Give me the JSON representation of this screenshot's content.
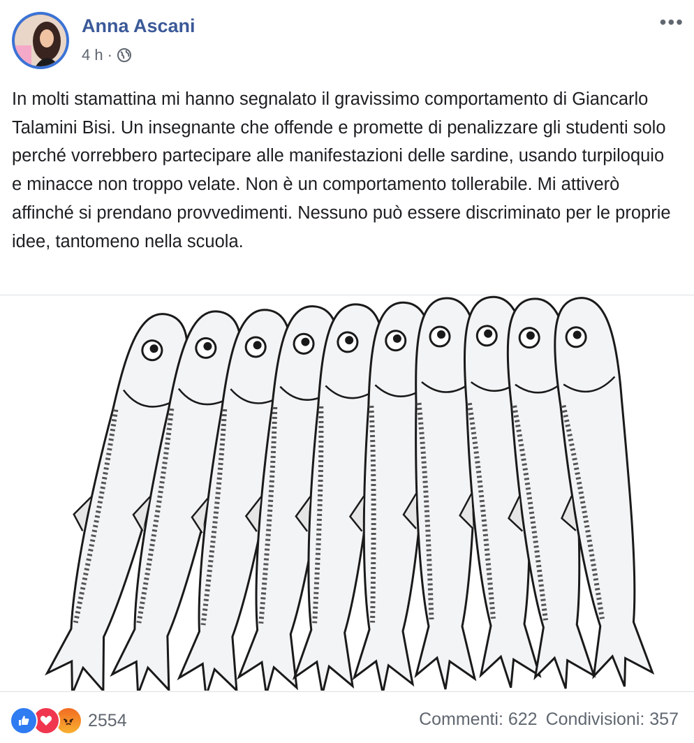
{
  "post": {
    "author": "Anna Ascani",
    "time": "4 h",
    "separator": "·",
    "more_label": "•••",
    "text": "In molti stamattina mi hanno segnalato il gravissimo comportamento di Giancarlo Talamini Bisi. Un insegnante che offende e promette di penalizzare gli studenti solo perché vorrebbero partecipare alle manifestazioni delle sardine, usando turpiloquio e minacce non troppo velate. Non è un comportamento tollerabile. Mi attiverò affinché si prendano provvedimenti. Nessuno può essere discriminato per le proprie idee, tantomeno nella scuola."
  },
  "image": {
    "subject": "sardines-drawing",
    "fish_count": 10
  },
  "footer": {
    "reaction_icons": [
      "like-icon",
      "love-icon",
      "angry-icon"
    ],
    "reaction_count": "2554",
    "comments": "Commenti: 622",
    "shares": "Condivisioni: 357"
  },
  "colors": {
    "author": "#3b5998",
    "like": "#2e7bf2",
    "love": "#f0364e",
    "angry": "#f26b22",
    "meta": "#606770"
  }
}
